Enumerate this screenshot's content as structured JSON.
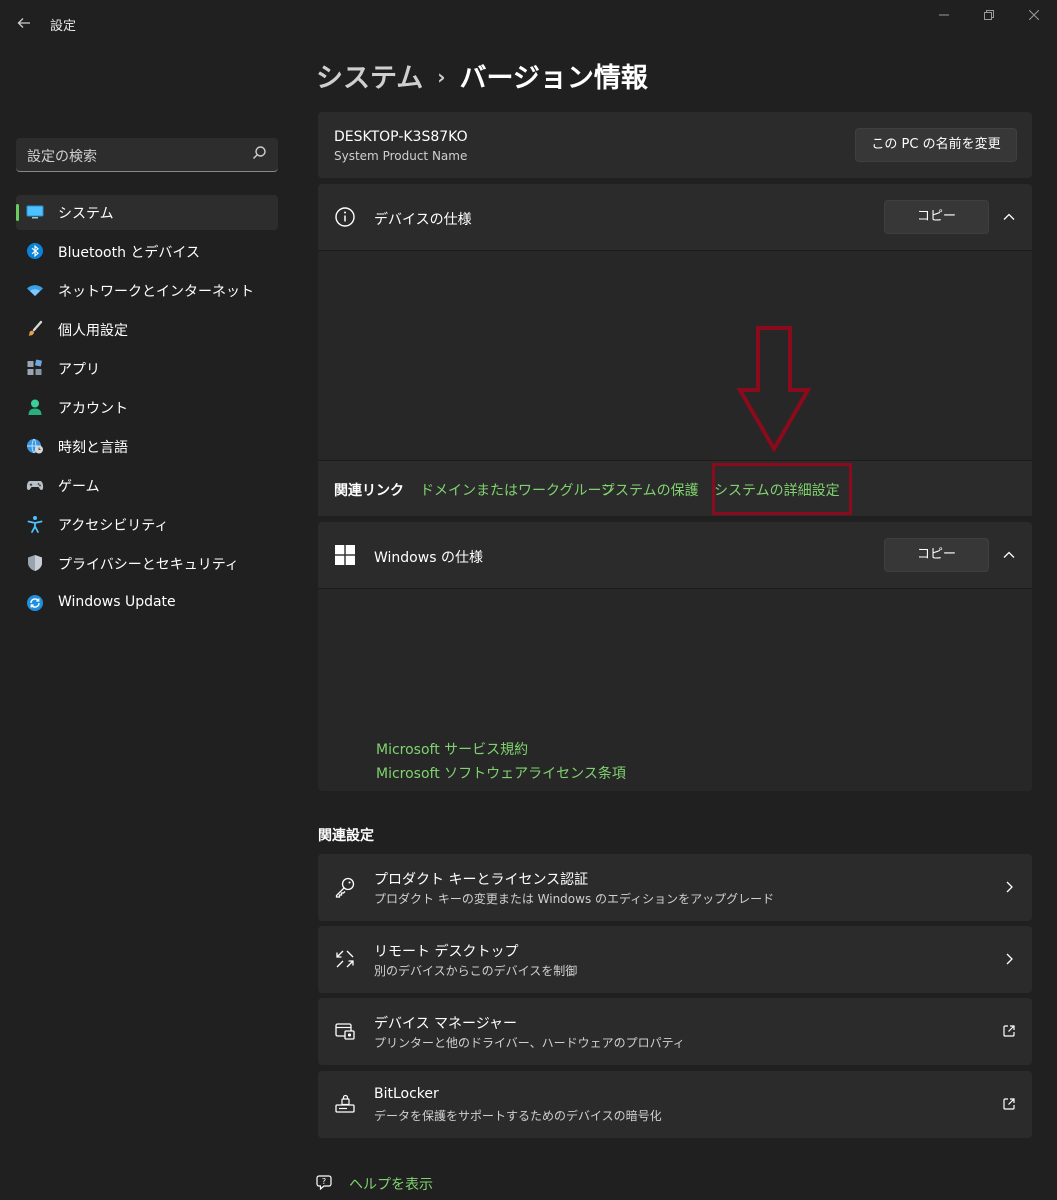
{
  "window": {
    "title": "設定",
    "back_icon": "back-arrow-icon",
    "controls": [
      "minimize-icon",
      "restore-icon",
      "close-icon"
    ]
  },
  "sidebar": {
    "search_placeholder": "設定の検索",
    "items": [
      {
        "label": "システム",
        "icon": "monitor-icon",
        "active": true
      },
      {
        "label": "Bluetooth とデバイス",
        "icon": "bluetooth-icon"
      },
      {
        "label": "ネットワークとインターネット",
        "icon": "wifi-icon"
      },
      {
        "label": "個人用設定",
        "icon": "brush-icon"
      },
      {
        "label": "アプリ",
        "icon": "apps-icon"
      },
      {
        "label": "アカウント",
        "icon": "person-icon"
      },
      {
        "label": "時刻と言語",
        "icon": "globe-clock-icon"
      },
      {
        "label": "ゲーム",
        "icon": "gamepad-icon"
      },
      {
        "label": "アクセシビリティ",
        "icon": "accessibility-icon"
      },
      {
        "label": "プライバシーとセキュリティ",
        "icon": "shield-icon"
      },
      {
        "label": "Windows Update",
        "icon": "update-icon"
      }
    ]
  },
  "breadcrumb": {
    "parent": "システム",
    "separator": "›",
    "current": "バージョン情報"
  },
  "device": {
    "name": "DESKTOP-K3S87KO",
    "product": "System Product Name",
    "rename_button": "この PC の名前を変更"
  },
  "device_specs": {
    "title": "デバイスの仕様",
    "copy_button": "コピー"
  },
  "related_links": {
    "label": "関連リンク",
    "links": [
      "ドメインまたはワークグループ",
      "システムの保護",
      "システムの詳細設定"
    ]
  },
  "windows_specs": {
    "title": "Windows の仕様",
    "copy_button": "コピー",
    "links": [
      "Microsoft サービス規約",
      "Microsoft ソフトウェアライセンス条項"
    ]
  },
  "related_settings": {
    "header": "関連設定",
    "items": [
      {
        "title": "プロダクト キーとライセンス認証",
        "subtitle": "プロダクト キーの変更または Windows のエディションをアップグレード",
        "icon": "key-icon",
        "trail": "chevron-right-icon"
      },
      {
        "title": "リモート デスクトップ",
        "subtitle": "別のデバイスからこのデバイスを制御",
        "icon": "remote-desktop-icon",
        "trail": "chevron-right-icon"
      },
      {
        "title": "デバイス マネージャー",
        "subtitle": "プリンターと他のドライバー、ハードウェアのプロパティ",
        "icon": "device-manager-icon",
        "trail": "external-link-icon"
      },
      {
        "title": "BitLocker",
        "subtitle": "データを保護をサポートするためのデバイスの暗号化",
        "icon": "bitlocker-icon",
        "trail": "external-link-icon"
      }
    ]
  },
  "help": {
    "label": "ヘルプを表示",
    "icon": "help-chat-icon"
  },
  "annotation": {
    "arrow_color": "#8b0a1c"
  },
  "colors": {
    "accent": "#6ccb5f",
    "link": "#7fd36f",
    "background": "#202020",
    "card": "#2b2b2b"
  }
}
